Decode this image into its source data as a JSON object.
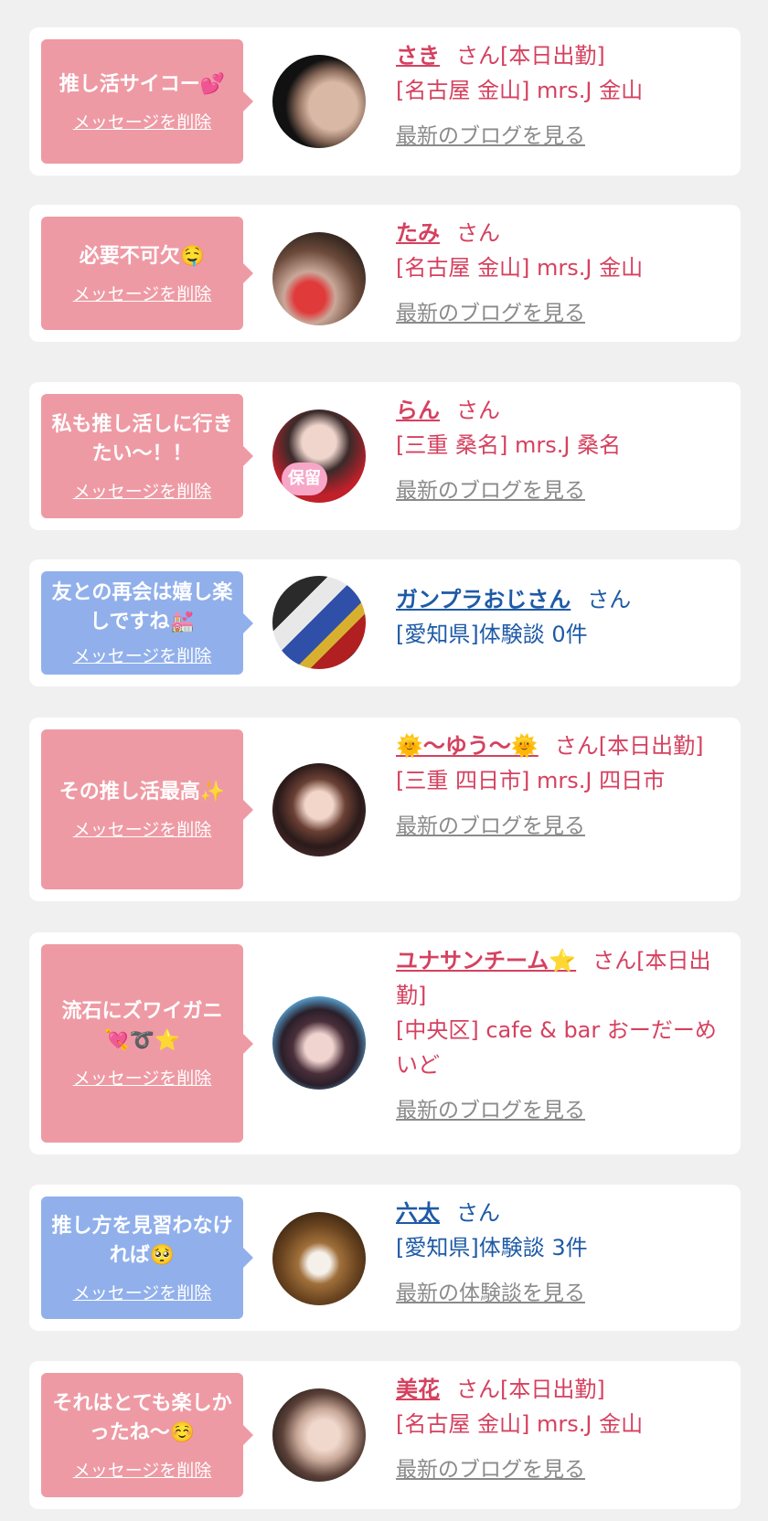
{
  "cards": [
    {
      "msg": "推し活サイコー💕",
      "del": "メッセージを削除",
      "name": "さき",
      "suffix": "さん[本日出勤]",
      "shop": "[名古屋 金山] mrs.J 金山",
      "link": "最新のブログを見る",
      "bubble": "pink",
      "avatar": "avatar-photo-1"
    },
    {
      "msg": "必要不可欠🤤",
      "del": "メッセージを削除",
      "name": "たみ",
      "suffix": "さん",
      "shop": "[名古屋 金山] mrs.J 金山",
      "link": "最新のブログを見る",
      "bubble": "pink",
      "avatar": "avatar-photo-2"
    },
    {
      "msg": "私も推し活しに行きたい〜！！",
      "del": "メッセージを削除",
      "name": "らん",
      "suffix": "さん",
      "shop": "[三重 桑名] mrs.J 桑名",
      "link": "最新のブログを見る",
      "bubble": "pink",
      "avatar": "avatar-photo-3",
      "stamp": "保留"
    },
    {
      "msg": "友との再会は嬉し楽しですね💒",
      "del": "メッセージを削除",
      "name": "ガンプラおじさん",
      "suffix": "さん",
      "shop": "[愛知県]体験談 0件",
      "link": "",
      "bubble": "blue",
      "avatar": "avatar-photo-4"
    },
    {
      "msg": "その推し活最高✨",
      "del": "メッセージを削除",
      "name": "🌞〜ゆう〜🌞",
      "suffix": "さん[本日出勤]",
      "shop": "[三重 四日市] mrs.J 四日市",
      "link": "最新のブログを見る",
      "bubble": "pink",
      "avatar": "avatar-photo-5"
    },
    {
      "msg": "流石にズワイガニ💘➰⭐",
      "del": "メッセージを削除",
      "name": "ユナサンチーム⭐",
      "suffix": "さん[本日出勤]",
      "shop": "[中央区] cafe & bar おーだーめいど",
      "link": "最新のブログを見る",
      "bubble": "pink",
      "avatar": "avatar-photo-6"
    },
    {
      "msg": "推し方を見習わなければ🥺",
      "del": "メッセージを削除",
      "name": "六太",
      "suffix": "さん",
      "shop": "[愛知県]体験談 3件",
      "link": "最新の体験談を見る",
      "bubble": "blue",
      "avatar": "avatar-photo-7"
    },
    {
      "msg": "それはとても楽しかったね〜☺️",
      "del": "メッセージを削除",
      "name": "美花",
      "suffix": "さん[本日出勤]",
      "shop": "[名古屋 金山] mrs.J 金山",
      "link": "最新のブログを見る",
      "bubble": "pink",
      "avatar": "avatar-photo-8"
    }
  ]
}
